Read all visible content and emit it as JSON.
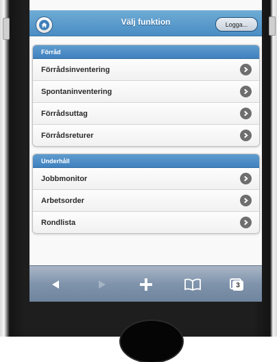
{
  "header": {
    "title": "Välj funktion",
    "logout_label": "Logga..."
  },
  "groups": [
    {
      "label": "Förråd",
      "items": [
        {
          "label": "Förrådsinventering"
        },
        {
          "label": "Spontaninventering"
        },
        {
          "label": "Förrådsuttag"
        },
        {
          "label": "Förrådsreturer"
        }
      ]
    },
    {
      "label": "Underhåll",
      "items": [
        {
          "label": "Jobbmonitor"
        },
        {
          "label": "Arbetsorder"
        },
        {
          "label": "Rondlista"
        }
      ]
    }
  ],
  "toolbar": {
    "tabs_count": "3"
  },
  "colors": {
    "header_blue": "#4a8dc4",
    "divider_blue": "#3f80bf",
    "toolbar_gray": "#7f93ab"
  },
  "icons": [
    "home-icon",
    "chevron-right-icon",
    "back-icon",
    "forward-icon",
    "add-icon",
    "bookmarks-icon",
    "tabs-icon"
  ]
}
